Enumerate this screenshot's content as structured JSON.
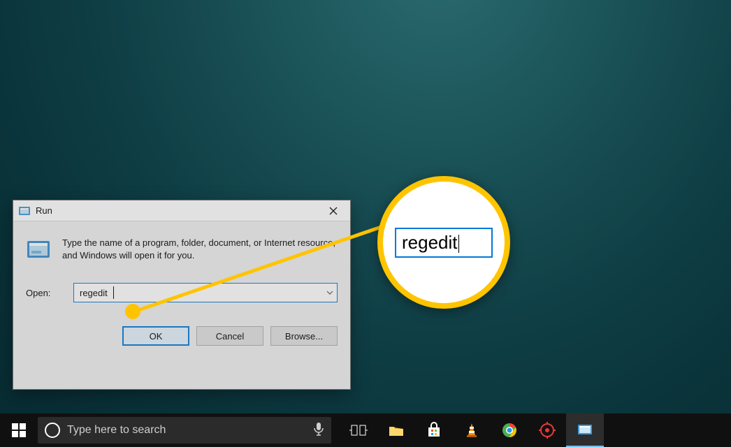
{
  "dialog": {
    "title": "Run",
    "description": "Type the name of a program, folder, document, or Internet resource, and Windows will open it for you.",
    "open_label": "Open:",
    "input_value": "regedit",
    "buttons": {
      "ok": "OK",
      "cancel": "Cancel",
      "browse": "Browse..."
    }
  },
  "zoom": {
    "value": "regedit"
  },
  "taskbar": {
    "search_placeholder": "Type here to search"
  },
  "colors": {
    "accent": "#0078d7",
    "highlight": "#ffc400"
  }
}
